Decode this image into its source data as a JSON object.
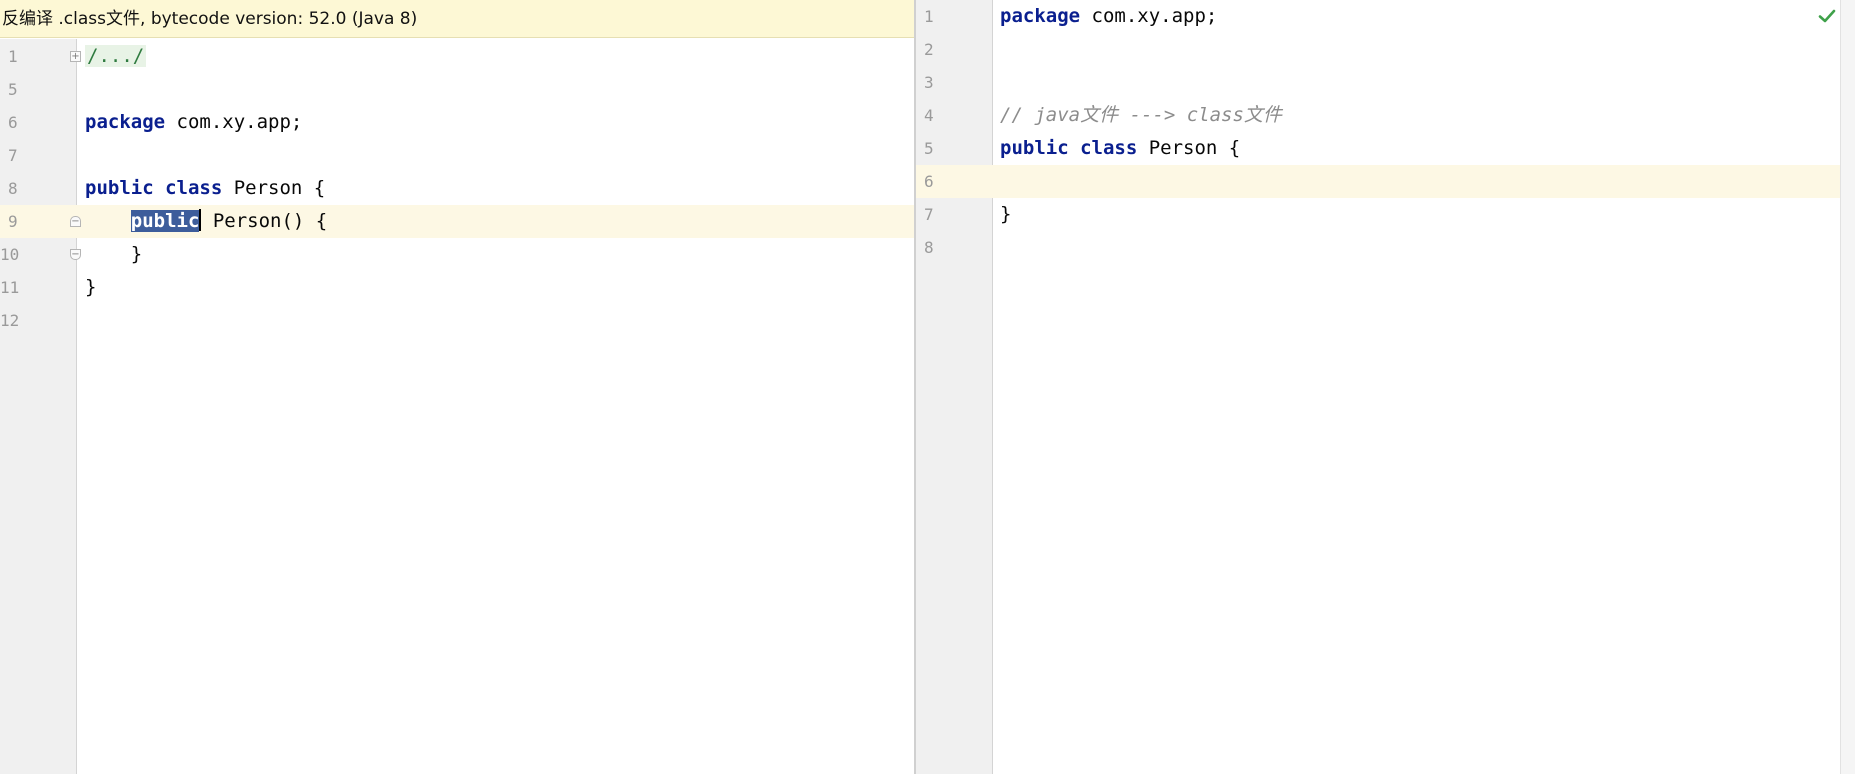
{
  "banner": {
    "text": "反编译 .class文件, bytecode version: 52.0 (Java 8)"
  },
  "left_editor": {
    "line_numbers": [
      "1",
      "5",
      "6",
      "7",
      "8",
      "9",
      "10",
      "11",
      "12"
    ],
    "code": {
      "fold_placeholder": "/.../",
      "package_kw": "package",
      "package_rest": " com.xy.app;",
      "class_kw1": "public",
      "class_kw2": "class",
      "class_rest": " Person {",
      "ctor_kw": "public",
      "ctor_rest": " Person() {",
      "ctor_close": "    }",
      "class_close": "}"
    }
  },
  "right_editor": {
    "line_numbers": [
      "1",
      "2",
      "3",
      "4",
      "5",
      "6",
      "7",
      "8"
    ],
    "code": {
      "package_kw": "package",
      "package_rest": " com.xy.app;",
      "comment": "// java文件 ---> class文件",
      "class_kw1": "public",
      "class_kw2": "class",
      "class_rest": " Person {",
      "class_close": "}"
    },
    "status_icon": "checkmark-icon"
  },
  "colors": {
    "keyword": "#0a1f8f",
    "comment": "#8c8c8c",
    "selection": "#3d5d9b",
    "current_line": "#fdf8e4",
    "banner": "#fdf8d5",
    "check": "#3fa14a"
  }
}
